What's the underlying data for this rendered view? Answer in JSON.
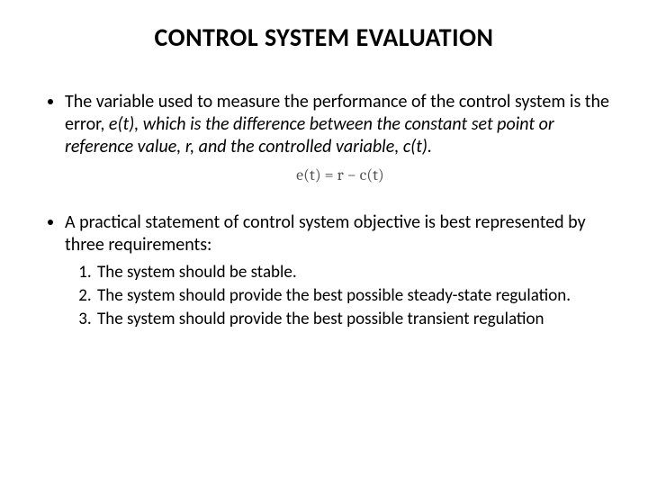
{
  "title": "CONTROL SYSTEM EVALUATION",
  "bullet1": {
    "pre": "The variable used to measure the performance of the control system is the error, ",
    "i1": "e(t), which is the difference between the constant set point or reference value, r, and the controlled variable, c(t)."
  },
  "equation": "e(t) = r − c(t)",
  "bullet2": "A practical statement of control system objective is best represented by three requirements:",
  "reqs": {
    "r1": "The system should be stable.",
    "r2": "The system should provide the best possible steady-state regulation.",
    "r3": "The system should provide the best possible transient regulation"
  }
}
